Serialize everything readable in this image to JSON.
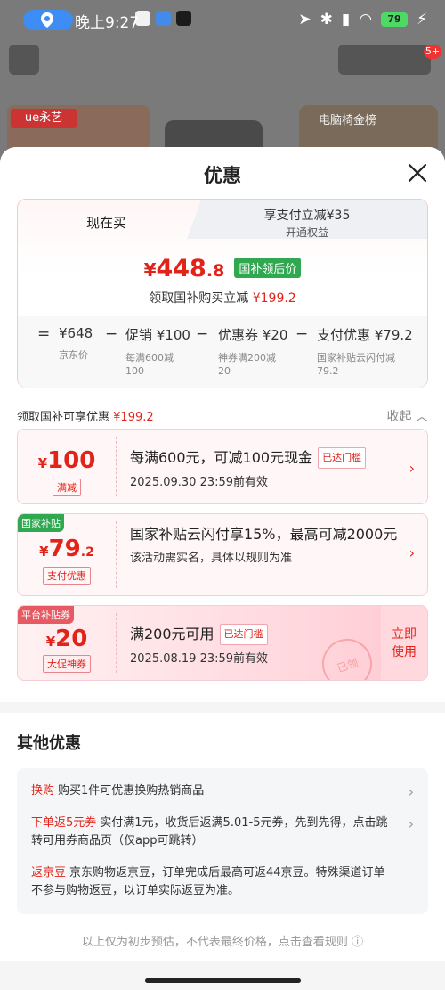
{
  "status": {
    "time": "晚上9:27",
    "battery": "79"
  },
  "background": {
    "brand_logo": "ue永艺",
    "ranking_label": "电脑椅金榜",
    "notification_count": "5+"
  },
  "sheet": {
    "title": "优惠",
    "tabs": {
      "now_label": "现在买",
      "pay_label": "享支付立减¥35",
      "pay_sub": "开通权益"
    },
    "price": {
      "currency": "¥",
      "integer": "448",
      "decimal": ".8",
      "tag": "国补领后价"
    },
    "subline": {
      "text": "领取国补购买立减",
      "amount": "¥199.2"
    },
    "formula": [
      {
        "op": "=",
        "value": "¥648",
        "desc": "京东价"
      },
      {
        "op": "−",
        "value": "促销 ¥100",
        "desc": "每满600减\n100"
      },
      {
        "op": "−",
        "value": "优惠券 ¥20",
        "desc": "神券满200减\n20"
      },
      {
        "op": "−",
        "value": "支付优惠 ¥79.2",
        "desc": "国家补贴云闪付减\n79.2"
      }
    ],
    "collapse_row": {
      "text": "领取国补可享优惠",
      "amount": "¥199.2",
      "toggle": "收起"
    }
  },
  "coupons": [
    {
      "corner": "",
      "currency": "¥",
      "amount": "100",
      "decimal": "",
      "label": "满减",
      "title": "每满600元，可减100元现金",
      "badge": "已达门槛",
      "subtitle": "2025.09.30 23:59前有效"
    },
    {
      "corner": "国家补贴",
      "currency": "¥",
      "amount": "79",
      "decimal": ".2",
      "label": "支付优惠",
      "title": "国家补贴云闪付享15%，最高可减2000元",
      "badge": "",
      "subtitle": "该活动需实名，具体以规则为准"
    },
    {
      "corner": "平台补贴券",
      "currency": "¥",
      "amount": "20",
      "decimal": "",
      "label": "大促神券",
      "title": "满200元可用",
      "badge": "已达门槛",
      "subtitle": "2025.08.19 23:59前有效",
      "action": "立即\n使用",
      "stamp": "已领"
    }
  ],
  "other": {
    "title": "其他优惠",
    "items": [
      {
        "tag": "换购",
        "text": "购买1件可优惠换购热销商品"
      },
      {
        "tag": "下单返5元券",
        "text": "实付满1元，收货后返满5.01-5元券，先到先得，点击跳转可用券商品页（仅app可跳转）"
      },
      {
        "tag": "返京豆",
        "text": "京东购物返京豆，订单完成后最高可返44京豆。特殊渠道订单不参与购物返豆，以订单实际返豆为准。"
      }
    ]
  },
  "footer": "以上仅为初步预估，不代表最终价格，点击查看规则"
}
